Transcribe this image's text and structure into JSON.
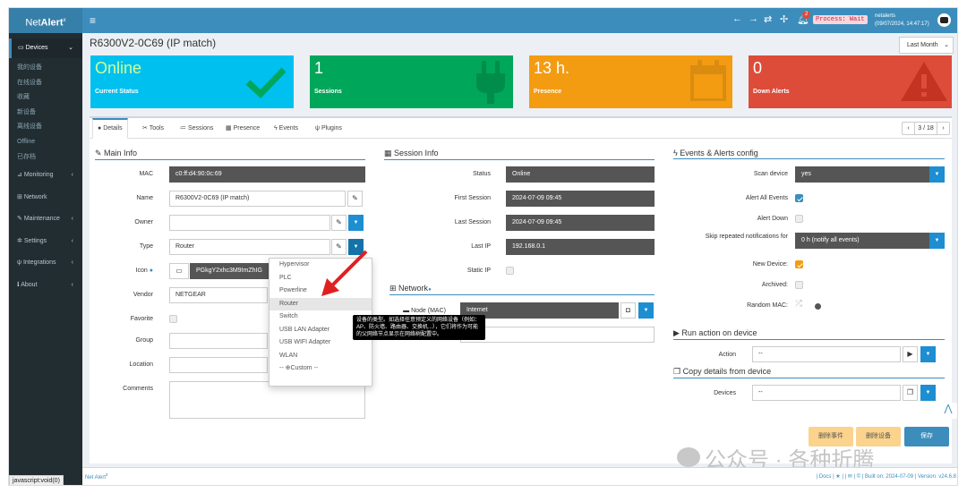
{
  "app": {
    "logo_main": "Net",
    "logo_bold": "Alert",
    "logo_sup": "x",
    "footer_brand": "Net Alert",
    "footer_sup": "x"
  },
  "topbar": {
    "notification_count": "2",
    "process_label": "Process: Wait",
    "user_name": "netalerts",
    "user_time": "(09/07/2024, 14:47:17)"
  },
  "sidebar": {
    "devices": "Devices",
    "sub_items": [
      "我的设备",
      "在线设备",
      "收藏",
      "新设备",
      "离线设备",
      "Offline",
      "已存档"
    ],
    "items": [
      {
        "label": "Monitoring",
        "icon": "chart-icon"
      },
      {
        "label": "Network",
        "icon": "sitemap-icon"
      },
      {
        "label": "Maintenance",
        "icon": "wrench-icon"
      },
      {
        "label": "Settings",
        "icon": "cog-icon"
      },
      {
        "label": "Integrations",
        "icon": "plug-icon"
      },
      {
        "label": "About",
        "icon": "info-icon"
      }
    ],
    "status_text": "javascript:void(0)"
  },
  "page": {
    "title": "R6300V2-0C69 (IP match)",
    "period": "Last Month"
  },
  "tiles": [
    {
      "big": "Online",
      "label": "Current Status",
      "color": "#00c0ef",
      "icon": "check-icon"
    },
    {
      "big": "1",
      "label": "Sessions",
      "color": "#00a65a",
      "icon": "plug-icon"
    },
    {
      "big": "13 h.",
      "label": "Presence",
      "color": "#f39c12",
      "icon": "calendar-icon"
    },
    {
      "big": "0",
      "label": "Down Alerts",
      "color": "#dd4b39",
      "icon": "warning-icon"
    }
  ],
  "tabs": [
    "Details",
    "Tools",
    "Sessions",
    "Presence",
    "Events",
    "Plugins"
  ],
  "pager": "3 / 18",
  "main_info": {
    "title": "Main Info",
    "mac_label": "MAC",
    "mac": "c0:ff:d4:90:0c:69",
    "name_label": "Name",
    "name": "R6300V2-0C69 (IP match)",
    "owner_label": "Owner",
    "owner": "",
    "type_label": "Type",
    "type": "Router",
    "icon_label": "Icon",
    "icon_value": "PGkgY2xhc3M9ImZhIG",
    "vendor_label": "Vendor",
    "vendor": "NETGEAR",
    "favorite_label": "Favorite",
    "group_label": "Group",
    "location_label": "Location",
    "comments_label": "Comments"
  },
  "dropdown": [
    "Hypervisor",
    "PLC",
    "Powerline",
    "Router",
    "Switch",
    "USB LAN Adapter",
    "USB WIFI Adapter",
    "WLAN",
    "-- ⊕Custom --"
  ],
  "tooltip": "设备的类型。如选择任意预定义的网络设备（例如：AP、防火墙、路由器、交换机...），它们将作为可能的父网络节点显示在网络树配置中。",
  "session": {
    "title": "Session Info",
    "status_label": "Status",
    "status": "Online",
    "first_label": "First Session",
    "first": "2024-07-09  09:45",
    "last_label": "Last Session",
    "last": "2024-07-09  09:45",
    "ip_label": "Last IP",
    "ip": "192.168.0.1",
    "static_label": "Static IP"
  },
  "network": {
    "title": "Network",
    "node_label": "Node (MAC)",
    "node": "Internet"
  },
  "events": {
    "title": "Events & Alerts config",
    "scan_label": "Scan device",
    "scan": "yes",
    "alert_all_label": "Alert All Events",
    "alert_down_label": "Alert Down",
    "skip_label": "Skip repeated notifications for",
    "skip": "0 h (notify all events)",
    "new_label": "New Device:",
    "archived_label": "Archived:",
    "random_label": "Random MAC:"
  },
  "run": {
    "title": "Run action on device",
    "action_label": "Action",
    "action": "--"
  },
  "copy": {
    "title": "Copy details from device",
    "devices_label": "Devices",
    "devices": "--"
  },
  "buttons": {
    "delete_events": "删除事件",
    "delete_device": "删除设备",
    "save": "保存"
  },
  "footer_right": "| Docs  | ★ |  | ✉ | © | Built on: 2024-07-09 | Version: v24.6.8",
  "watermark": "公众号 · 各种折腾"
}
